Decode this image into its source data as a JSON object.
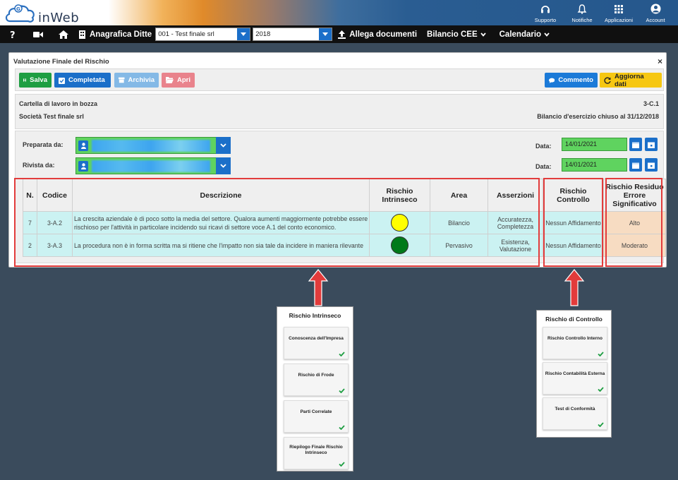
{
  "app": {
    "brand": "inWeb"
  },
  "topnav": [
    {
      "label": "Supporto",
      "icon": "headset-icon"
    },
    {
      "label": "Notifiche",
      "icon": "bell-icon"
    },
    {
      "label": "Applicazioni",
      "icon": "grid-icon"
    },
    {
      "label": "Account",
      "icon": "user-icon"
    }
  ],
  "toolbar": {
    "anagrafica_label": "Anagrafica Ditte",
    "company_value": "001 - Test finale srl",
    "year_value": "2018",
    "allega_label": "Allega documenti",
    "bilancio_label": "Bilancio CEE",
    "calendario_label": "Calendario"
  },
  "modal": {
    "title": "Valutazione Finale del Rischio",
    "close": "×",
    "buttons": {
      "salva": "Salva",
      "completata": "Completata",
      "archivia": "Archivia",
      "apri": "Apri",
      "commento": "Commento",
      "aggiorna": "Aggiorna dati"
    },
    "info": {
      "status": "Cartella di lavoro in bozza",
      "company": "Società Test finale srl",
      "code": "3-C.1",
      "exercise": "Bilancio d'esercizio chiuso al 31/12/2018"
    },
    "form": {
      "preparata_label": "Preparata da:",
      "rivista_label": "Rivista da:",
      "data_label": "Data:",
      "preparata_date": "14/01/2021",
      "rivista_date": "14/01/2021"
    },
    "table": {
      "headers": {
        "n": "N.",
        "codice": "Codice",
        "descrizione": "Descrizione",
        "rischio_intrinseco": "Rischio Intrinseco",
        "area": "Area",
        "asserzioni": "Asserzioni",
        "rischio_controllo": "Rischio Controllo",
        "rischio_residuo": "Rischio Residuo Errore Significativo"
      },
      "rows": [
        {
          "n": "7",
          "codice": "3-A.2",
          "descrizione": "La crescita aziendale è di poco sotto la media del settore. Qualora aumenti maggiormente potrebbe essere rischioso per l'attività in particolare incidendo sui ricavi di settore voce A.1 del conto economico.",
          "indicator_color": "#ffff00",
          "area": "Bilancio",
          "asserzioni": "Accuratezza, Completezza",
          "rischio_controllo": "Nessun Affidamento",
          "rischio_residuo": "Alto"
        },
        {
          "n": "2",
          "codice": "3-A.3",
          "descrizione": "La procedura non è in forma scritta ma si ritiene che l'impatto non sia tale da incidere in maniera rilevante",
          "indicator_color": "#007a1a",
          "area": "Pervasivo",
          "asserzioni": "Esistenza, Valutazione",
          "rischio_controllo": "Nessun Affidamento",
          "rischio_residuo": "Moderato"
        }
      ]
    }
  },
  "card_intrinseco": {
    "title": "Rischio Intrinseco",
    "tiles": [
      "Conoscenza dell'Impresa",
      "Rischio di Frode",
      "Parti Correlate",
      "Riepilogo Finale Rischio Intrinseco"
    ]
  },
  "card_controllo": {
    "title": "Rischio di Controllo",
    "tiles": [
      "Rischio Controllo Interno",
      "Rischio Contabilità Esterna",
      "Test di Conformità"
    ]
  }
}
